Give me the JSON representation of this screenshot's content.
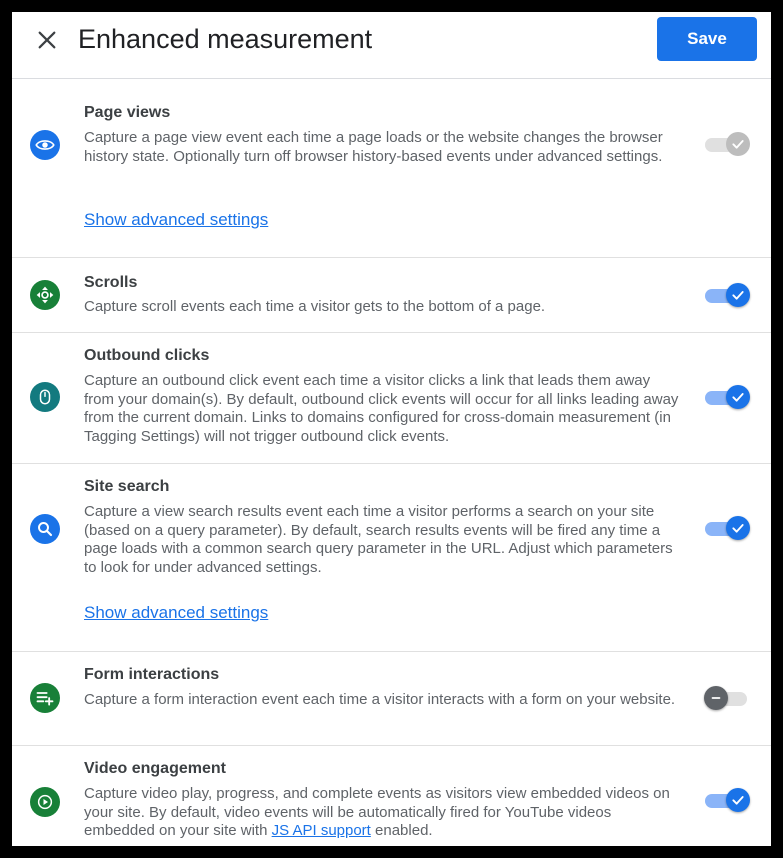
{
  "header": {
    "title": "Enhanced measurement",
    "save_label": "Save"
  },
  "sections": [
    {
      "title": "Page views",
      "description": "Capture a page view event each time a page loads or the website changes the browser history state. Optionally turn off browser history-based events under advanced settings.",
      "link": "Show advanced settings",
      "icon": "eye-icon",
      "icon_color": "#1a73e8",
      "toggle_state": "on-disabled"
    },
    {
      "title": "Scrolls",
      "description": "Capture scroll events each time a visitor gets to the bottom of a page.",
      "icon": "scroll-arrows-icon",
      "icon_color": "#188038",
      "toggle_state": "on"
    },
    {
      "title": "Outbound clicks",
      "description": "Capture an outbound click event each time a visitor clicks a link that leads them away from your domain(s). By default, outbound click events will occur for all links leading away from the current domain. Links to domains configured for cross-domain measurement (in Tagging Settings) will not trigger outbound click events.",
      "icon": "mouse-icon",
      "icon_color": "#137a7f",
      "toggle_state": "on"
    },
    {
      "title": "Site search",
      "description": "Capture a view search results event each time a visitor performs a search on your site (based on a query parameter). By default, search results events will be fired any time a page loads with a common search query parameter in the URL. Adjust which parameters to look for under advanced settings.",
      "link": "Show advanced settings",
      "icon": "search-icon",
      "icon_color": "#1a73e8",
      "toggle_state": "on"
    },
    {
      "title": "Form interactions",
      "description": "Capture a form interaction event each time a visitor interacts with a form on your website.",
      "icon": "playlist-add-icon",
      "icon_color": "#188038",
      "toggle_state": "off"
    },
    {
      "title": "Video engagement",
      "description_before_link": "Capture video play, progress, and complete events as visitors view embedded videos on your site. By default, video events will be automatically fired for YouTube videos embedded on your site with ",
      "description_link": "JS API support",
      "description_after_link": " enabled.",
      "icon": "play-icon",
      "icon_color": "#188038",
      "toggle_state": "on"
    }
  ]
}
